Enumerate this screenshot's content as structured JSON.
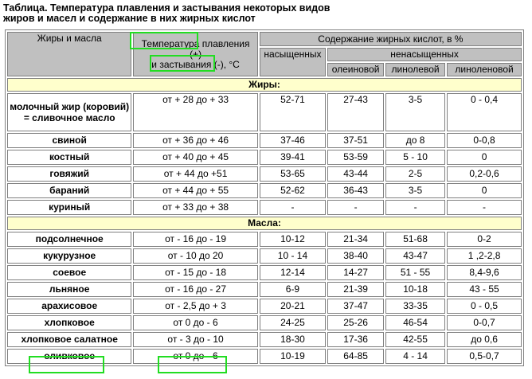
{
  "caption_line1": "Таблица. Температура плавления и застывания некоторых видов",
  "caption_line2": "жиров и масел и содержание в них жирных кислот",
  "header": {
    "col_name": "Жиры и масла",
    "col_temp_w1": "Температура",
    "col_temp_w2": "плавления",
    "col_temp_w3": "(+)",
    "col_temp_w4": "и",
    "col_temp_w5": "застывания",
    "col_temp_w6": "(-), °С",
    "col_acids": "Содержание жирных кислот, в %",
    "saturated": "насыщенных",
    "unsaturated": "ненасыщенных",
    "oleic": "олеиновой",
    "linoleic": "линолевой",
    "linolenic": "линоленовой"
  },
  "section_fats": "Жиры:",
  "section_oils": "Масла:",
  "fats": [
    {
      "name": "молочный жир (коровий) = сливочное масло",
      "temp": "от + 28 до + 33",
      "sat": "52-71",
      "oleic": "27-43",
      "linoleic": "3-5",
      "linolenic": "0 - 0,4"
    },
    {
      "name": "свиной",
      "temp": "от + 36 до + 46",
      "sat": "37-46",
      "oleic": "37-51",
      "linoleic": "до 8",
      "linolenic": "0-0,8"
    },
    {
      "name": "костный",
      "temp": "от + 40 до + 45",
      "sat": "39-41",
      "oleic": "53-59",
      "linoleic": "5 - 10",
      "linolenic": "0"
    },
    {
      "name": "говяжий",
      "temp": "от + 44 до +51",
      "sat": "53-65",
      "oleic": "43-44",
      "linoleic": "2-5",
      "linolenic": "0,2-0,6"
    },
    {
      "name": "бараний",
      "temp": "от + 44 до + 55",
      "sat": "52-62",
      "oleic": "36-43",
      "linoleic": "3-5",
      "linolenic": "0"
    },
    {
      "name": "куриный",
      "temp": "от + 33 до + 38",
      "sat": "-",
      "oleic": "-",
      "linoleic": "-",
      "linolenic": "-"
    }
  ],
  "oils": [
    {
      "name": "подсолнечное",
      "temp": "от - 16 до - 19",
      "sat": "10-12",
      "oleic": "21-34",
      "linoleic": "51-68",
      "linolenic": "0-2"
    },
    {
      "name": "кукурузное",
      "temp": "от - 10 до 20",
      "sat": "10 - 14",
      "oleic": "38-40",
      "linoleic": "43-47",
      "linolenic": "1 ,2-2,8"
    },
    {
      "name": "соевое",
      "temp": "от - 15 до - 18",
      "sat": "12-14",
      "oleic": "14-27",
      "linoleic": "51 - 55",
      "linolenic": "8,4-9,6"
    },
    {
      "name": "льняное",
      "temp": "от - 16 до - 27",
      "sat": "6-9",
      "oleic": "21-39",
      "linoleic": "10-18",
      "linolenic": "43 - 55"
    },
    {
      "name": "арахисовое",
      "temp": "от - 2,5 до + 3",
      "sat": "20-21",
      "oleic": "37-47",
      "linoleic": "33-35",
      "linolenic": "0 - 0,5"
    },
    {
      "name": "хлопковое",
      "temp": "от 0 до - 6",
      "sat": "24-25",
      "oleic": "25-26",
      "linoleic": "46-54",
      "linolenic": "0-0,7"
    },
    {
      "name": "хлопковое салатное",
      "temp": "от - 3 до - 10",
      "sat": "18-30",
      "oleic": "17-36",
      "linoleic": "42-55",
      "linolenic": "до 0,6"
    },
    {
      "name": "оливковое",
      "temp": "от 0 до - 6",
      "sat": "10-19",
      "oleic": "64-85",
      "linoleic": "4 - 14",
      "linolenic": "0,5-0,7"
    }
  ],
  "highlight_color": "#22dd22"
}
